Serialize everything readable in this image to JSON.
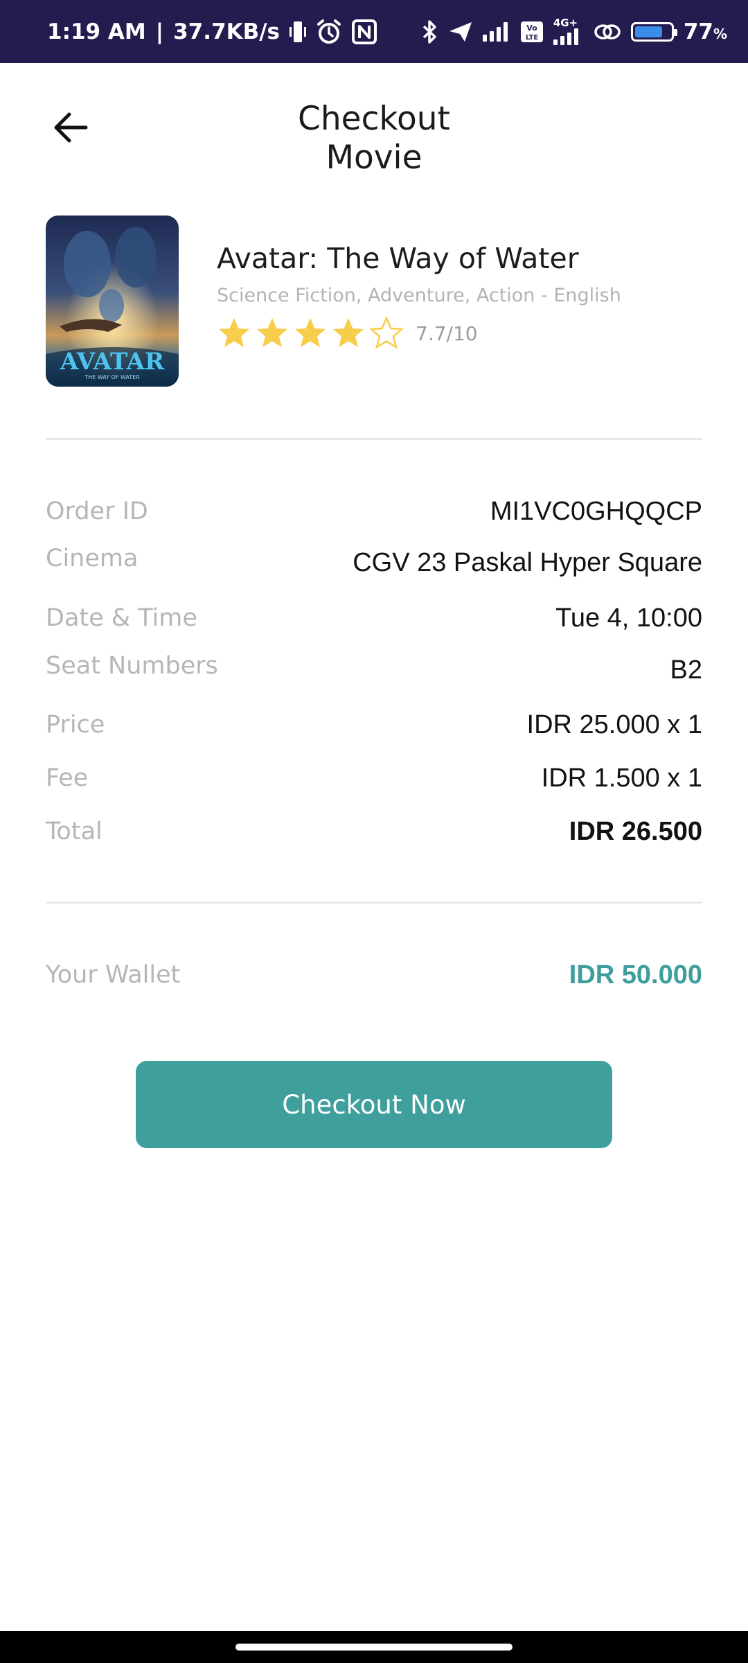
{
  "status_bar": {
    "time": "1:19 AM",
    "separator": "|",
    "network_speed": "37.7KB/s",
    "battery_percent": "77",
    "battery_level": 0.77,
    "icons": [
      "vibrate-icon",
      "alarm-icon",
      "nfc-icon",
      "bluetooth-icon",
      "airplane-icon",
      "signal-icon",
      "volte-icon",
      "4g-signal-icon",
      "hotspot-icon",
      "battery-icon"
    ],
    "volte_label": "Vo LTE",
    "network_type": "4G+"
  },
  "header": {
    "back_icon": "arrow-left-icon",
    "title_line1": "Checkout",
    "title_line2": "Movie"
  },
  "movie": {
    "poster_text": "AVATAR",
    "poster_subtext": "THE WAY OF WATER",
    "title": "Avatar: The Way of Water",
    "genre": "Science Fiction, Adventure, Action - English",
    "stars_filled": 4,
    "stars_total": 5,
    "rating_text": "7.7/10",
    "star_color": "#f7cd4c"
  },
  "details": {
    "order_id_label": "Order ID",
    "order_id_value": "MI1VC0GHQQCP",
    "cinema_label": "Cinema",
    "cinema_value": "CGV 23 Paskal Hyper Square",
    "datetime_label": "Date & Time",
    "datetime_value": "Tue 4, 10:00",
    "seat_label": "Seat Numbers",
    "seat_value": "B2",
    "price_label": "Price",
    "price_value": "IDR 25.000 x 1",
    "fee_label": "Fee",
    "fee_value": "IDR 1.500 x 1",
    "total_label": "Total",
    "total_value": "IDR 26.500"
  },
  "wallet": {
    "label": "Your Wallet",
    "value": "IDR 50.000",
    "color": "#3d9e9b"
  },
  "checkout_button": {
    "label": "Checkout Now",
    "color": "#3f9f9d"
  }
}
